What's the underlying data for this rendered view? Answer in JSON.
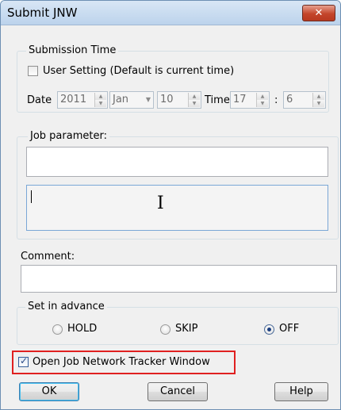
{
  "window": {
    "title": "Submit JNW",
    "close_glyph": "✕"
  },
  "submission_time": {
    "legend": "Submission Time",
    "user_setting_label": "User Setting (Default is current time)",
    "user_setting_checked": false,
    "date_label": "Date",
    "year": "2011",
    "month": "Jan",
    "day": "10",
    "time_label": "Time",
    "hour": "17",
    "time_sep": ":",
    "minute": "6"
  },
  "job_parameter": {
    "legend": "Job parameter:",
    "value_1": "",
    "value_2": "",
    "cursor_glyph": "I"
  },
  "comment": {
    "label": "Comment:",
    "value": ""
  },
  "set_in_advance": {
    "legend": "Set in advance",
    "options": [
      {
        "label": "HOLD",
        "selected": false
      },
      {
        "label": "SKIP",
        "selected": false
      },
      {
        "label": "OFF",
        "selected": true
      }
    ]
  },
  "tracker": {
    "label": "Open Job Network Tracker Window",
    "checked": true
  },
  "buttons": {
    "ok": "OK",
    "cancel": "Cancel",
    "help": "Help"
  },
  "colors": {
    "highlight": "#e02020",
    "close_button": "#c4452b"
  }
}
